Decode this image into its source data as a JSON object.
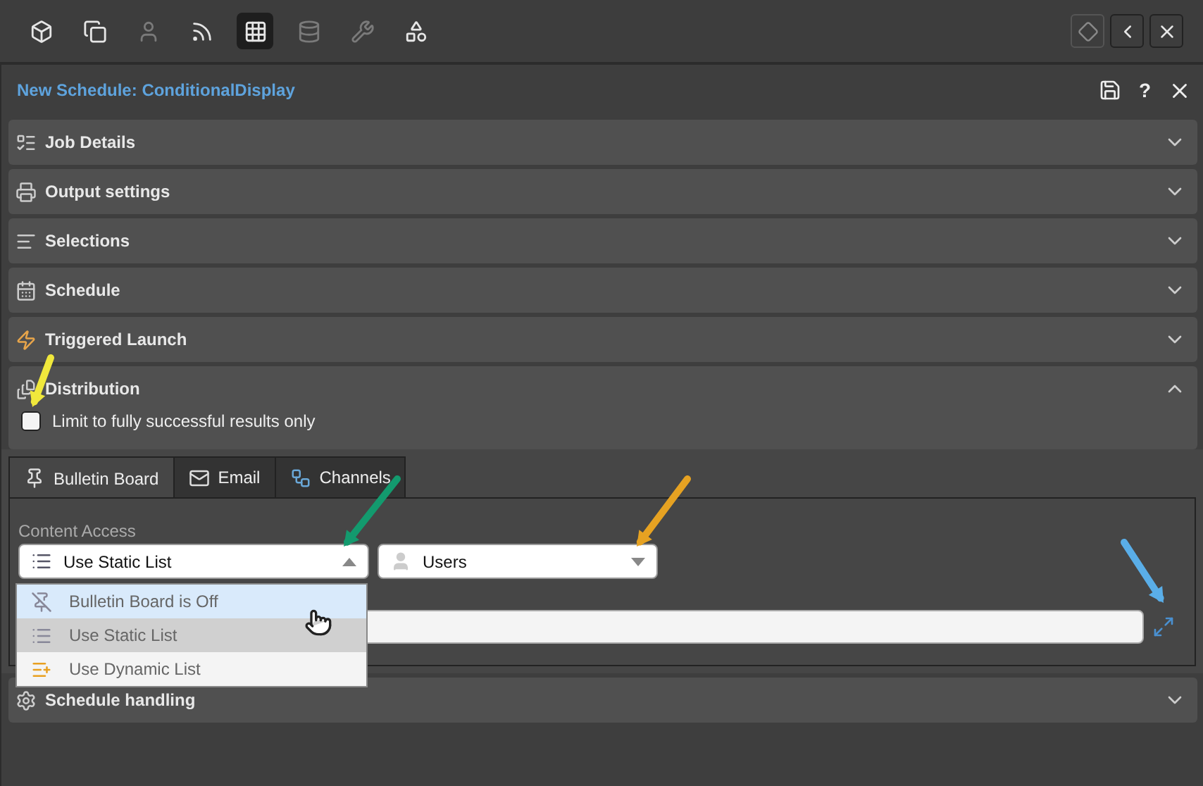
{
  "toolbar": {
    "tools": [
      {
        "disabled": false,
        "selected": false
      },
      {
        "disabled": false,
        "selected": false
      },
      {
        "disabled": true,
        "selected": false
      },
      {
        "disabled": false,
        "selected": false
      },
      {
        "disabled": false,
        "selected": true
      },
      {
        "disabled": true,
        "selected": false
      },
      {
        "disabled": true,
        "selected": false
      },
      {
        "disabled": false,
        "selected": false
      }
    ],
    "right_buttons": [
      {
        "disabled": true
      },
      {
        "disabled": false
      },
      {
        "disabled": false
      }
    ]
  },
  "header": {
    "title": "New Schedule: ConditionalDisplay",
    "help": "?"
  },
  "sections": [
    {
      "title": "Job Details",
      "expanded": false
    },
    {
      "title": "Output settings",
      "expanded": false
    },
    {
      "title": "Selections",
      "expanded": false
    },
    {
      "title": "Schedule",
      "expanded": false
    },
    {
      "title": "Triggered Launch",
      "expanded": false
    },
    {
      "title": "Distribution",
      "expanded": true
    }
  ],
  "distribution": {
    "checkbox": {
      "label": "Limit to fully successful results only",
      "checked": false
    },
    "tabs": [
      {
        "label": "Bulletin Board",
        "selected": true
      },
      {
        "label": "Email",
        "selected": false
      },
      {
        "label": "Channels",
        "selected": false
      }
    ],
    "content_access": {
      "label": "Content Access",
      "select": {
        "value": "Use Static List",
        "open": true
      },
      "users_select": {
        "value": "Users",
        "open": false
      },
      "options": [
        {
          "label": "Bulletin Board is Off",
          "selected": false,
          "hovered": true
        },
        {
          "label": "Use Static List",
          "selected": true,
          "hovered": false
        },
        {
          "label": "Use Dynamic List",
          "selected": false,
          "hovered": false
        }
      ]
    }
  },
  "after_sections": [
    {
      "title": "Schedule handling",
      "expanded": false
    }
  ],
  "annotations": [
    {
      "color": "#f0e83c"
    },
    {
      "color": "#139a6e"
    },
    {
      "color": "#e6a222"
    },
    {
      "color": "#5aaee8"
    }
  ]
}
